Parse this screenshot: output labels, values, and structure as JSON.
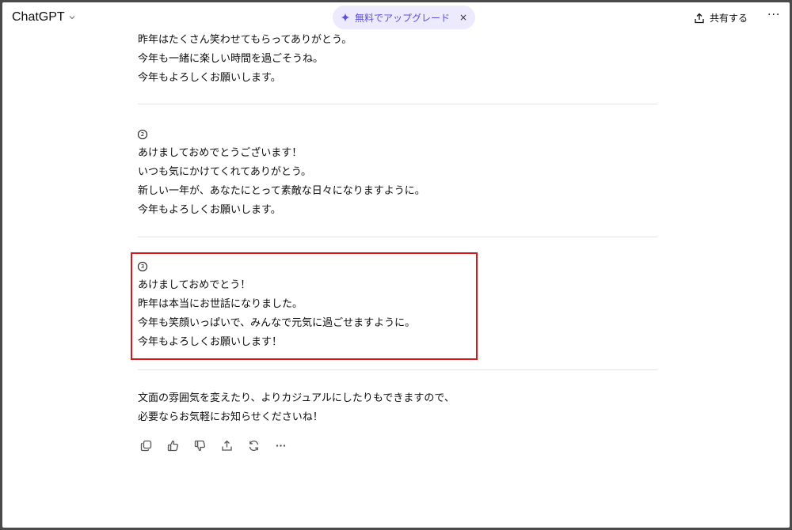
{
  "header": {
    "app_title": "ChatGPT",
    "upgrade_label": "無料でアップグレード",
    "upgrade_close": "×",
    "share_label": "共有する",
    "more_label": "···"
  },
  "messages": {
    "prev_lines": [
      "昨年はたくさん笑わせてもらってありがとう。",
      "今年も一緒に楽しい時間を過ごそうね。",
      "今年もよろしくお願いします。"
    ],
    "option2": {
      "number": "2",
      "lines": [
        "あけましておめでとうございます！",
        "いつも気にかけてくれてありがとう。",
        "新しい一年が、あなたにとって素敵な日々になりますように。",
        "今年もよろしくお願いします。"
      ]
    },
    "option3": {
      "number": "3",
      "lines": [
        "あけましておめでとう！",
        "昨年は本当にお世話になりました。",
        "今年も笑顔いっぱいで、みんなで元気に過ごせますように。",
        "今年もよろしくお願いします！"
      ]
    },
    "closing_lines": [
      "文面の雰囲気を変えたり、よりカジュアルにしたりもできますので、",
      "必要ならお気軽にお知らせくださいね！"
    ]
  },
  "colors": {
    "accent": "#5b4fe0",
    "highlight_border": "#d81818",
    "divider": "#e3e3e3"
  },
  "icons": {
    "upgrade": "sparkle-icon",
    "share": "share-icon",
    "actions": [
      "copy-icon",
      "thumbs-up-icon",
      "thumbs-down-icon",
      "share-icon",
      "regenerate-icon",
      "more-icon"
    ]
  }
}
